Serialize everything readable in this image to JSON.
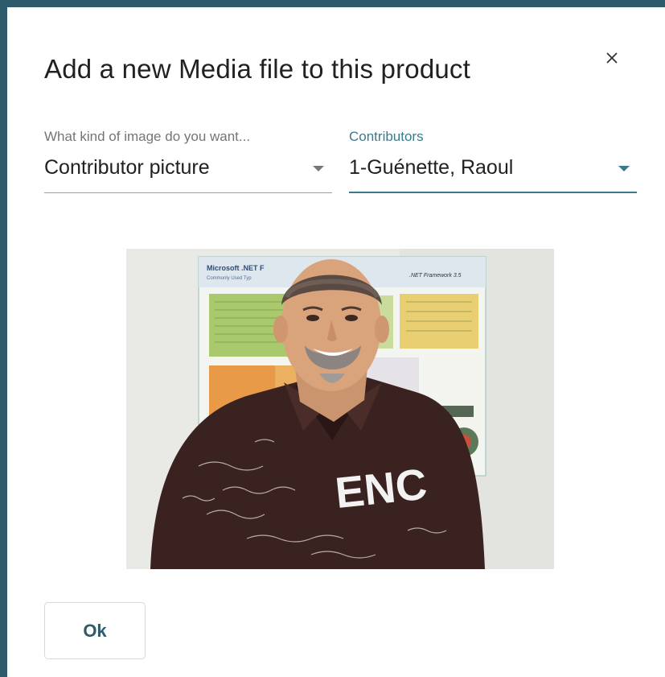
{
  "dialog": {
    "title": "Add a new Media file to this product",
    "close_icon": "close-icon"
  },
  "fields": {
    "image_kind": {
      "label": "What kind of image do you want...",
      "value": "Contributor picture",
      "icon": "chevron-down-icon"
    },
    "contributors": {
      "label": "Contributors",
      "value": "1-Guénette, Raoul",
      "icon": "chevron-down-icon"
    }
  },
  "photo": {
    "description_icon": "contributor-photo",
    "poster_title": "Microsoft .NET F",
    "poster_subtitle": "Commonly Used Typ",
    "poster_logo": ".NET Framework 3.5",
    "poster_version": "5",
    "shirt_text": "ENC"
  },
  "actions": {
    "ok_label": "Ok"
  },
  "colors": {
    "accent": "#2d5b6b",
    "accent_light": "#3b7a8c",
    "text": "#212121",
    "label": "#757575"
  }
}
